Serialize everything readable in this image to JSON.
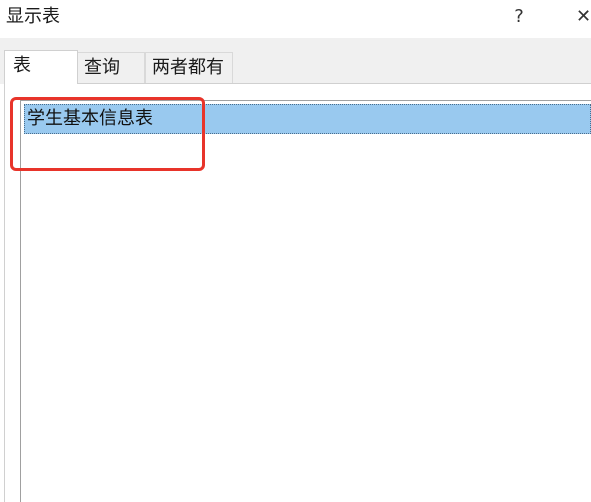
{
  "window": {
    "title": "显示表",
    "help_glyph": "?",
    "close_glyph": "✕"
  },
  "tabs": [
    {
      "label": "表",
      "active": true
    },
    {
      "label": "查询",
      "active": false
    },
    {
      "label": "两者都有",
      "active": false
    }
  ],
  "list": {
    "items": [
      {
        "label": "学生基本信息表",
        "selected": true
      }
    ]
  },
  "colors": {
    "selection": "#99c9ef",
    "highlight_box": "#e8342a",
    "tabstrip_bg": "#f0f0f0"
  }
}
